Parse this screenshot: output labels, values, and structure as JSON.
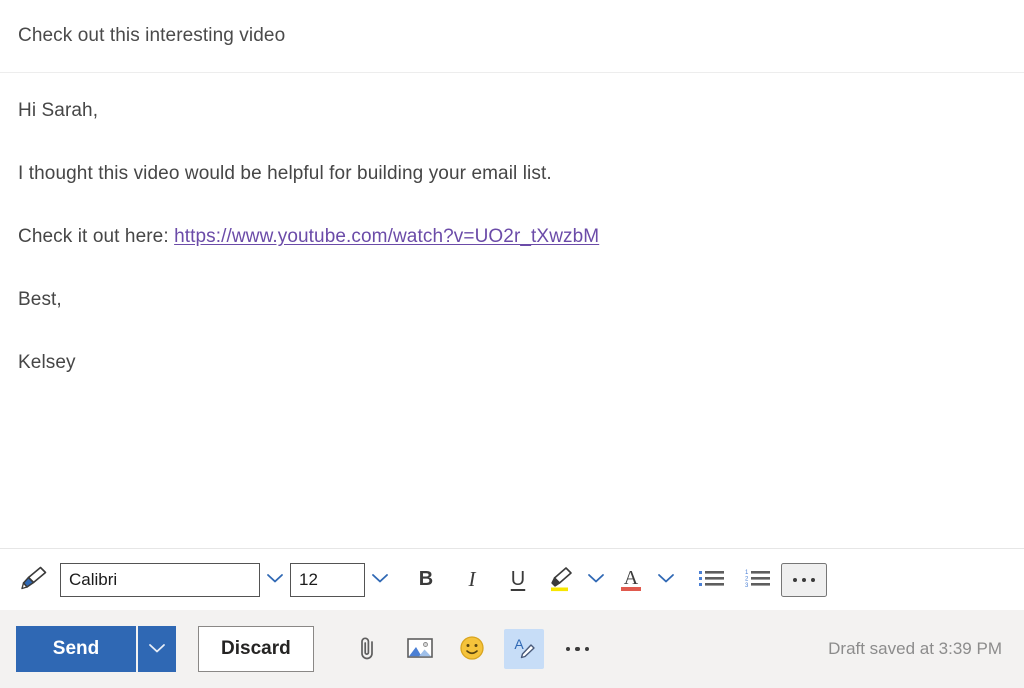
{
  "compose": {
    "subject": "Check out this interesting video",
    "body": {
      "greeting": "Hi Sarah,",
      "paragraph": "I thought this video would be helpful for building your email list.",
      "link_prefix": "Check it out here: ",
      "link_text": "https://www.youtube.com/watch?v=UO2r_tXwzbM",
      "closing": "Best,",
      "signature": "Kelsey"
    }
  },
  "format_toolbar": {
    "format_painter": "format-painter-icon",
    "font_name": {
      "value": "Calibri",
      "dropdown": "chevron-down-icon"
    },
    "font_size": {
      "value": "12",
      "dropdown": "chevron-down-icon"
    },
    "bold": "B",
    "italic": "I",
    "underline": "U",
    "highlight": {
      "icon": "highlighter-icon",
      "color": "#f7e600",
      "dropdown": "chevron-down-icon"
    },
    "font_color": {
      "icon": "font-color-icon",
      "letter": "A",
      "color": "#e05a4e",
      "dropdown": "chevron-down-icon"
    },
    "bulleted_list": "bulleted-list-icon",
    "numbered_list": "numbered-list-icon",
    "more_options": "ellipsis-icon"
  },
  "action_bar": {
    "send_label": "Send",
    "send_dropdown": "chevron-down-icon",
    "discard_label": "Discard",
    "attach": "paperclip-icon",
    "insert_picture": "image-icon",
    "emoji": "emoji-icon",
    "formatting_toggle": "formatting-options-icon",
    "more_actions": "ellipsis-icon",
    "draft_status": "Draft saved at 3:39 PM"
  },
  "colors": {
    "accent": "#2f68b4",
    "link": "#6b4ba8",
    "action_bar_bg": "#f3f2f1",
    "active_toggle_bg": "#c7ddf7",
    "text": "#464646"
  }
}
